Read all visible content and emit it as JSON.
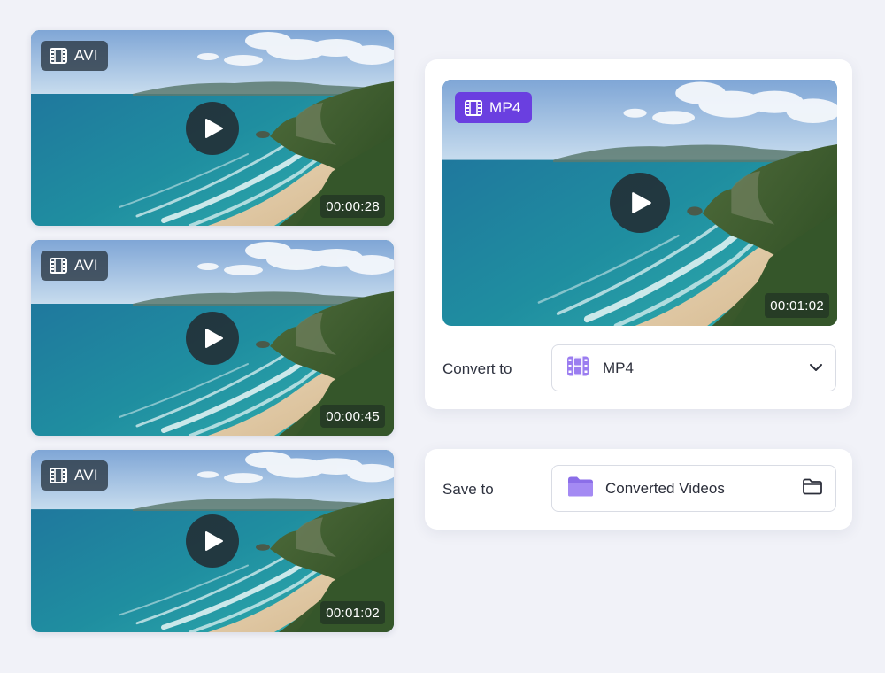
{
  "sources": [
    {
      "format": "AVI",
      "duration": "00:00:28",
      "format_icon": "film-icon"
    },
    {
      "format": "AVI",
      "duration": "00:00:45",
      "format_icon": "film-icon"
    },
    {
      "format": "AVI",
      "duration": "00:01:02",
      "format_icon": "film-icon"
    }
  ],
  "output": {
    "format": "MP4",
    "duration": "00:01:02",
    "format_icon": "film-icon"
  },
  "convert": {
    "label": "Convert to",
    "value": "MP4",
    "icon": "film-icon",
    "dropdown_icon": "chevron-down-icon"
  },
  "save": {
    "label": "Save to",
    "value": "Converted Videos",
    "icon": "folder-icon",
    "browse_icon": "folder-outline-icon"
  },
  "colors": {
    "accent": "#6a3fe0",
    "accent_light": "#9b7df0",
    "background": "#f1f2f8"
  }
}
